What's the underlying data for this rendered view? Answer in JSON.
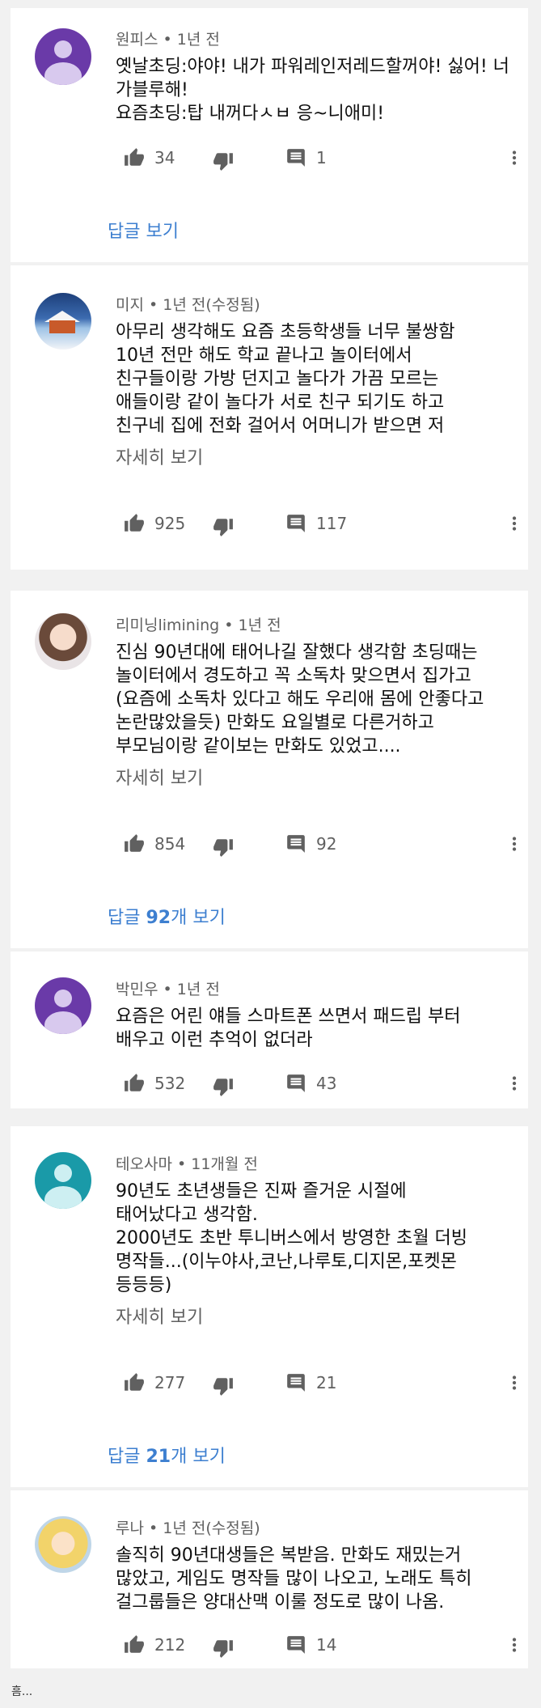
{
  "comments": [
    {
      "author": "원피스",
      "time": "1년 전",
      "text": "옛날초딩:야야! 내가 파워레인저레드할꺼야! 싫어! 너가블루해!\n요즘초딩:탑 내꺼다ㅅㅂ 응~니애미!",
      "likes": "34",
      "replies": "1",
      "replies_link": "답글 보기",
      "more": ""
    },
    {
      "author": "미지",
      "time": "1년 전(수정됨)",
      "text": "아무리 생각해도 요즘 초등학생들 너무 불쌍함\n10년 전만 해도 학교 끝나고 놀이터에서\n친구들이랑 가방 던지고 놀다가 가끔 모르는\n애들이랑 같이 놀다가 서로 친구 되기도 하고\n친구네 집에 전화 걸어서 어머니가 받으면 저",
      "likes": "925",
      "replies": "117",
      "more": "자세히 보기"
    },
    {
      "author": "리미닝limining",
      "time": "1년 전",
      "text": "진심 90년대에 태어나길 잘했다 생각함 초딩때는\n놀이터에서 경도하고 꼭 소독차 맞으면서 집가고\n(요즘에 소독차 있다고 해도 우리애 몸에 안좋다고\n논란많았을듯) 만화도 요일별로 다른거하고\n부모님이랑 같이보는 만화도 있었고....",
      "likes": "854",
      "replies": "92",
      "more": "자세히 보기",
      "replies_link_prefix": "답글 ",
      "replies_link_count": "92",
      "replies_link_suffix": "개 보기"
    },
    {
      "author": "박민우",
      "time": "1년 전",
      "text": "요즘은 어린 얘들 스마트폰 쓰면서 패드립 부터\n배우고 이런 추억이 없더라",
      "likes": "532",
      "replies": "43"
    },
    {
      "author": "테오사마",
      "time": "11개월 전",
      "text": "90년도 초년생들은 진짜 즐거운 시절에\n태어났다고 생각함.\n2000년도 초반 투니버스에서 방영한 초월 더빙\n명작들...(이누야사,코난,나루토,디지몬,포켓몬\n등등등)",
      "likes": "277",
      "replies": "21",
      "more": "자세히 보기",
      "replies_link_prefix": "답글 ",
      "replies_link_count": "21",
      "replies_link_suffix": "개 보기"
    },
    {
      "author": "루나",
      "time": "1년 전(수정됨)",
      "text": "솔직히 90년대생들은 복받음. 만화도 재밌는거\n많았고, 게임도 명작들 많이 나오고, 노래도 특히\n걸그룹들은 양대산맥 이룰 정도로 많이 나옴.",
      "likes": "212",
      "replies": "14"
    }
  ],
  "separator": "•",
  "footer_text": "흠..."
}
